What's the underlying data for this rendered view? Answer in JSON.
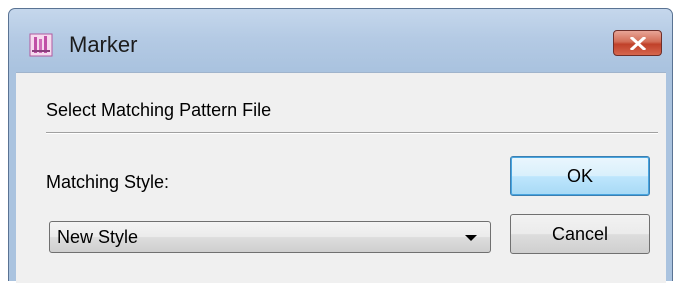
{
  "window": {
    "title": "Marker",
    "icon": "marker-app-icon",
    "close_icon": "close-icon"
  },
  "dialog": {
    "header": "Select Matching Pattern File",
    "style_label": "Matching Style:",
    "style_select": {
      "selected": "New Style"
    },
    "ok_label": "OK",
    "cancel_label": "Cancel"
  },
  "colors": {
    "titlebar": "#b4cae4",
    "client_bg": "#f0f0f0",
    "close_button": "#c0412a",
    "default_button_border": "#3c7fb1"
  }
}
